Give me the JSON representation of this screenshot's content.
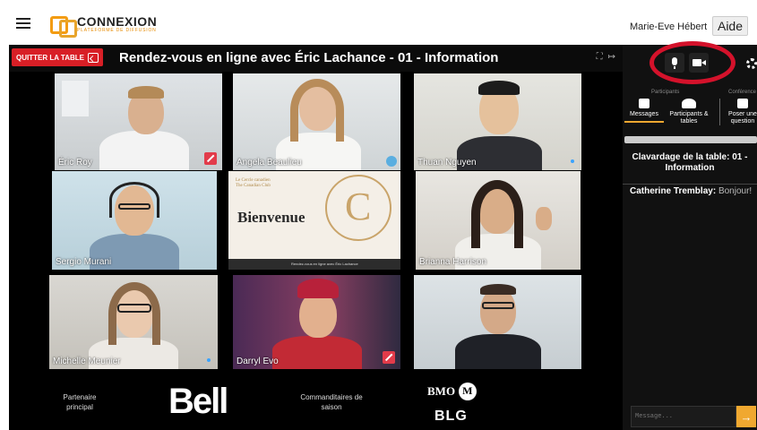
{
  "app": {
    "logo_name": "CONNEXION",
    "logo_tagline": "PLATEFORME DE DIFFUSION",
    "user_name": "Marie-Eve Hébert",
    "help_label": "Aide"
  },
  "room": {
    "quit_label": "QUITTER LA TABLE",
    "title": "Rendez-vous en ligne avec Éric Lachance - 01 - Information"
  },
  "participants": [
    {
      "name": "Éric Roy",
      "muted": true
    },
    {
      "name": "Angela Beaulieu",
      "muted": false
    },
    {
      "name": "Thuan Nguyen",
      "muted": false
    },
    {
      "name": "Sergio Murani",
      "muted": false
    },
    {
      "name": "Brianna Harrison",
      "muted": false
    },
    {
      "name": "Michelle Meunier",
      "muted": false
    },
    {
      "name": "Darryl Evo",
      "muted": true
    },
    {
      "name": "",
      "muted": false
    }
  ],
  "welcome_slide": {
    "brand": "Le Cercle canadien The Canadian Club",
    "title": "Bienvenue",
    "footer": "Rendez-vous en ligne avec Éric Lachance"
  },
  "sponsors": {
    "partner_label": "Partenaire principal",
    "partner_logo": "Bell",
    "season_label": "Commanditaires de saison",
    "sponsor1": "BMO",
    "sponsor2": "BLG"
  },
  "panel": {
    "group_participants": "Participants",
    "group_conference": "Conférence",
    "tab_messages": "Messages",
    "tab_participants": "Participants & tables",
    "tab_question": "Poser une question",
    "chat_title": "Clavardage de la table: 01 - Information",
    "messages": [
      {
        "author": "Catherine Tremblay:",
        "text": "Bonjour!"
      }
    ],
    "input_placeholder": "Message...",
    "send_icon": "→"
  }
}
